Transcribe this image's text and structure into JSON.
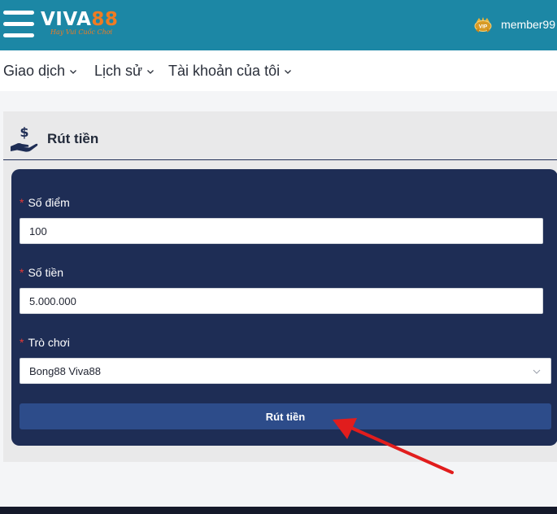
{
  "header": {
    "logo": {
      "text_main": "VIVA",
      "text_num": "88",
      "tagline": "Hay Vui Cuốc Chơi"
    },
    "user": {
      "badge": "VIP",
      "username": "member99"
    },
    "icons": {
      "menu": "hamburger-menu-icon",
      "vip": "vip-badge-icon"
    }
  },
  "nav": {
    "items": [
      {
        "label": "Giao dịch"
      },
      {
        "label": "Lịch sử"
      },
      {
        "label": "Tài khoản của tôi"
      }
    ]
  },
  "panel": {
    "title": "Rút tiền",
    "icon": "money-hand-icon",
    "form": {
      "points": {
        "label": "Số điểm",
        "value": "100",
        "required_mark": "*"
      },
      "amount": {
        "label": "Số tiền",
        "value": "5.000.000",
        "required_mark": "*"
      },
      "game": {
        "label": "Trò chơi",
        "value": "Bong88 Viva88",
        "required_mark": "*"
      },
      "submit_label": "Rút tiền"
    }
  },
  "annotation": {
    "icon": "red-arrow-annotation",
    "color": "#e11d1d"
  },
  "colors": {
    "header_bg": "#1c87a5",
    "form_bg": "#1e2d55",
    "button_bg": "#2d4c8a",
    "accent_orange": "#f07b22"
  }
}
